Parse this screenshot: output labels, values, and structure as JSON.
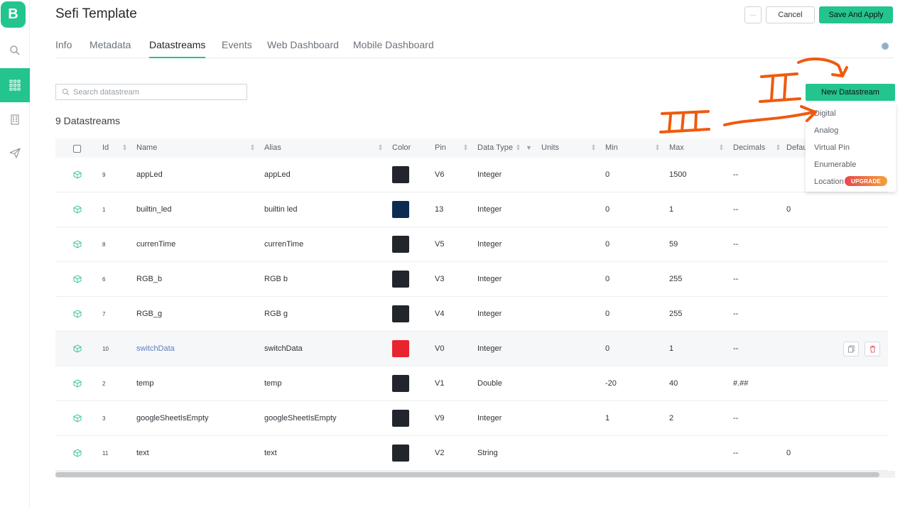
{
  "app": {
    "logo_letter": "B",
    "brand_color": "#23c48e"
  },
  "sidebar": {
    "items": [
      {
        "icon": "search-icon"
      },
      {
        "icon": "grid-icon",
        "active": true
      },
      {
        "icon": "building-icon"
      },
      {
        "icon": "send-icon"
      }
    ]
  },
  "header": {
    "title": "Sefi Template",
    "more_label": "···",
    "cancel_label": "Cancel",
    "save_label": "Save And Apply"
  },
  "tabs": [
    "Info",
    "Metadata",
    "Datastreams",
    "Events",
    "Web Dashboard",
    "Mobile Dashboard"
  ],
  "active_tab": "Datastreams",
  "search": {
    "placeholder": "Search datastream"
  },
  "count_label": "9 Datastreams",
  "new_button_label": "New Datastream",
  "columns": [
    "Id",
    "Name",
    "Alias",
    "Color",
    "Pin",
    "Data Type",
    "Units",
    "Min",
    "Max",
    "Decimals",
    "Defau"
  ],
  "rows": [
    {
      "id": "9",
      "name": "appLed",
      "alias": "appLed",
      "color": "#22252b",
      "pin": "V6",
      "type": "Integer",
      "units": "",
      "min": "0",
      "max": "1500",
      "decimals": "--",
      "default": ""
    },
    {
      "id": "1",
      "name": "builtin_led",
      "alias": "builtin led",
      "color": "#0d2c52",
      "pin": "13",
      "type": "Integer",
      "units": "",
      "min": "0",
      "max": "1",
      "decimals": "--",
      "default": "0"
    },
    {
      "id": "8",
      "name": "currenTime",
      "alias": "currenTime",
      "color": "#22252b",
      "pin": "V5",
      "type": "Integer",
      "units": "",
      "min": "0",
      "max": "59",
      "decimals": "--",
      "default": ""
    },
    {
      "id": "6",
      "name": "RGB_b",
      "alias": "RGB b",
      "color": "#22252b",
      "pin": "V3",
      "type": "Integer",
      "units": "",
      "min": "0",
      "max": "255",
      "decimals": "--",
      "default": ""
    },
    {
      "id": "7",
      "name": "RGB_g",
      "alias": "RGB g",
      "color": "#22252b",
      "pin": "V4",
      "type": "Integer",
      "units": "",
      "min": "0",
      "max": "255",
      "decimals": "--",
      "default": ""
    },
    {
      "id": "10",
      "name": "switchData",
      "alias": "switchData",
      "color": "#e8242e",
      "pin": "V0",
      "type": "Integer",
      "units": "",
      "min": "0",
      "max": "1",
      "decimals": "--",
      "default": "",
      "hovered": true
    },
    {
      "id": "2",
      "name": "temp",
      "alias": "temp",
      "color": "#22252b",
      "pin": "V1",
      "type": "Double",
      "units": "",
      "min": "-20",
      "max": "40",
      "decimals": "#.##",
      "default": ""
    },
    {
      "id": "3",
      "name": "googleSheetIsEmpty",
      "alias": "googleSheetIsEmpty",
      "color": "#22252b",
      "pin": "V9",
      "type": "Integer",
      "units": "",
      "min": "1",
      "max": "2",
      "decimals": "--",
      "default": ""
    },
    {
      "id": "11",
      "name": "text",
      "alias": "text",
      "color": "#22252b",
      "pin": "V2",
      "type": "String",
      "units": "",
      "min": "",
      "max": "",
      "decimals": "--",
      "default": "0"
    }
  ],
  "dropdown": {
    "items": [
      "Digital",
      "Analog",
      "Virtual Pin",
      "Enumerable",
      "Location"
    ],
    "upgrade_badge": "UPGRADE"
  },
  "annotation_color": "#f05a0e"
}
